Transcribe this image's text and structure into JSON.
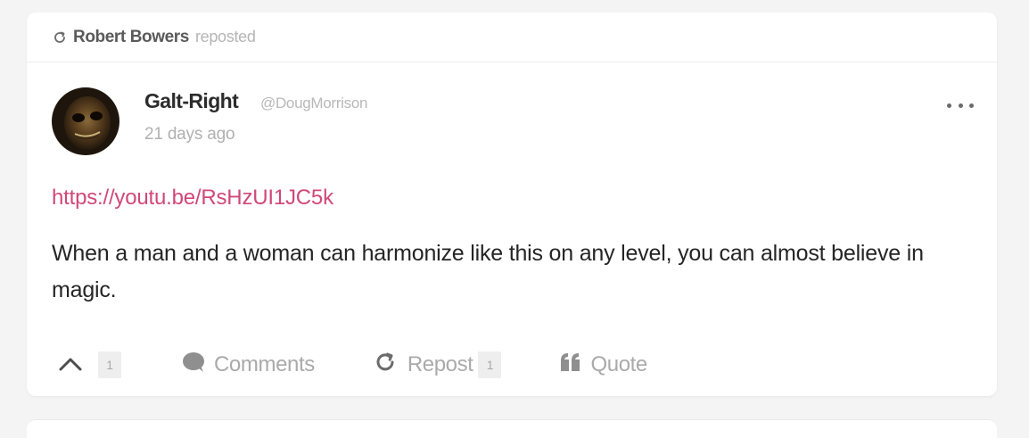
{
  "repost_header": {
    "icon": "repost-icon",
    "reposter_name": "Robert Bowers",
    "reposted_label": "reposted"
  },
  "post": {
    "author_name": "Galt-Right",
    "author_handle": "@DougMorrison",
    "timestamp": "21 days ago",
    "link": "https://youtu.be/RsHzUI1JC5k",
    "body": "When a man and a woman can harmonize like this on any level, you can almost believe in magic.",
    "more_icon": "ellipsis-icon"
  },
  "actions": {
    "upvote_count": "1",
    "comments_label": "Comments",
    "repost_label": "Repost",
    "repost_count": "1",
    "quote_label": "Quote"
  },
  "colors": {
    "link": "#d0487a",
    "muted": "#aaaaaa",
    "text": "#252525"
  }
}
